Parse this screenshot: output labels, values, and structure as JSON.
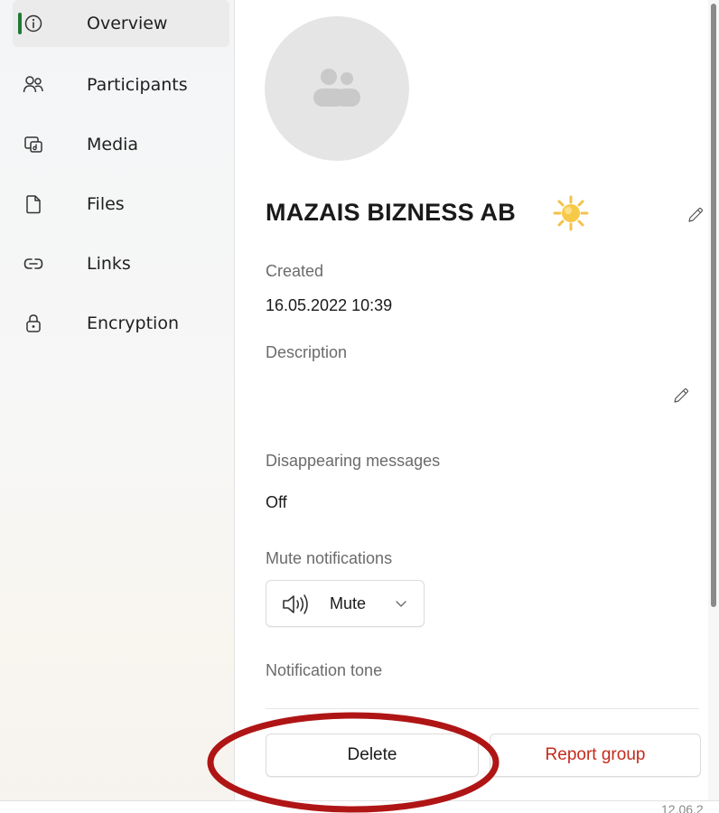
{
  "nav": {
    "items": [
      {
        "id": "overview",
        "label": "Overview",
        "icon": "info-icon",
        "active": true
      },
      {
        "id": "participants",
        "label": "Participants",
        "icon": "people-icon",
        "active": false
      },
      {
        "id": "media",
        "label": "Media",
        "icon": "media-icon",
        "active": false
      },
      {
        "id": "files",
        "label": "Files",
        "icon": "file-icon",
        "active": false
      },
      {
        "id": "links",
        "label": "Links",
        "icon": "link-icon",
        "active": false
      },
      {
        "id": "encryption",
        "label": "Encryption",
        "icon": "lock-icon",
        "active": false
      }
    ]
  },
  "group": {
    "name": "MAZAIS BIZNESS AB",
    "emoji_icon": "sun-icon",
    "avatar_icon": "group-avatar-icon"
  },
  "created": {
    "label": "Created",
    "value": "16.05.2022 10:39"
  },
  "description": {
    "label": "Description",
    "value": ""
  },
  "disappearing": {
    "label": "Disappearing messages",
    "value": "Off"
  },
  "mute": {
    "label": "Mute notifications",
    "button_label": "Mute"
  },
  "tone": {
    "label": "Notification tone"
  },
  "actions": {
    "delete_label": "Delete",
    "report_label": "Report group"
  },
  "timestamp": "12.06.2",
  "colors": {
    "accent_green": "#1e7a33",
    "danger_red": "#c42b1c",
    "annotation_red": "#b01515",
    "sun_yellow": "#f7c948"
  }
}
